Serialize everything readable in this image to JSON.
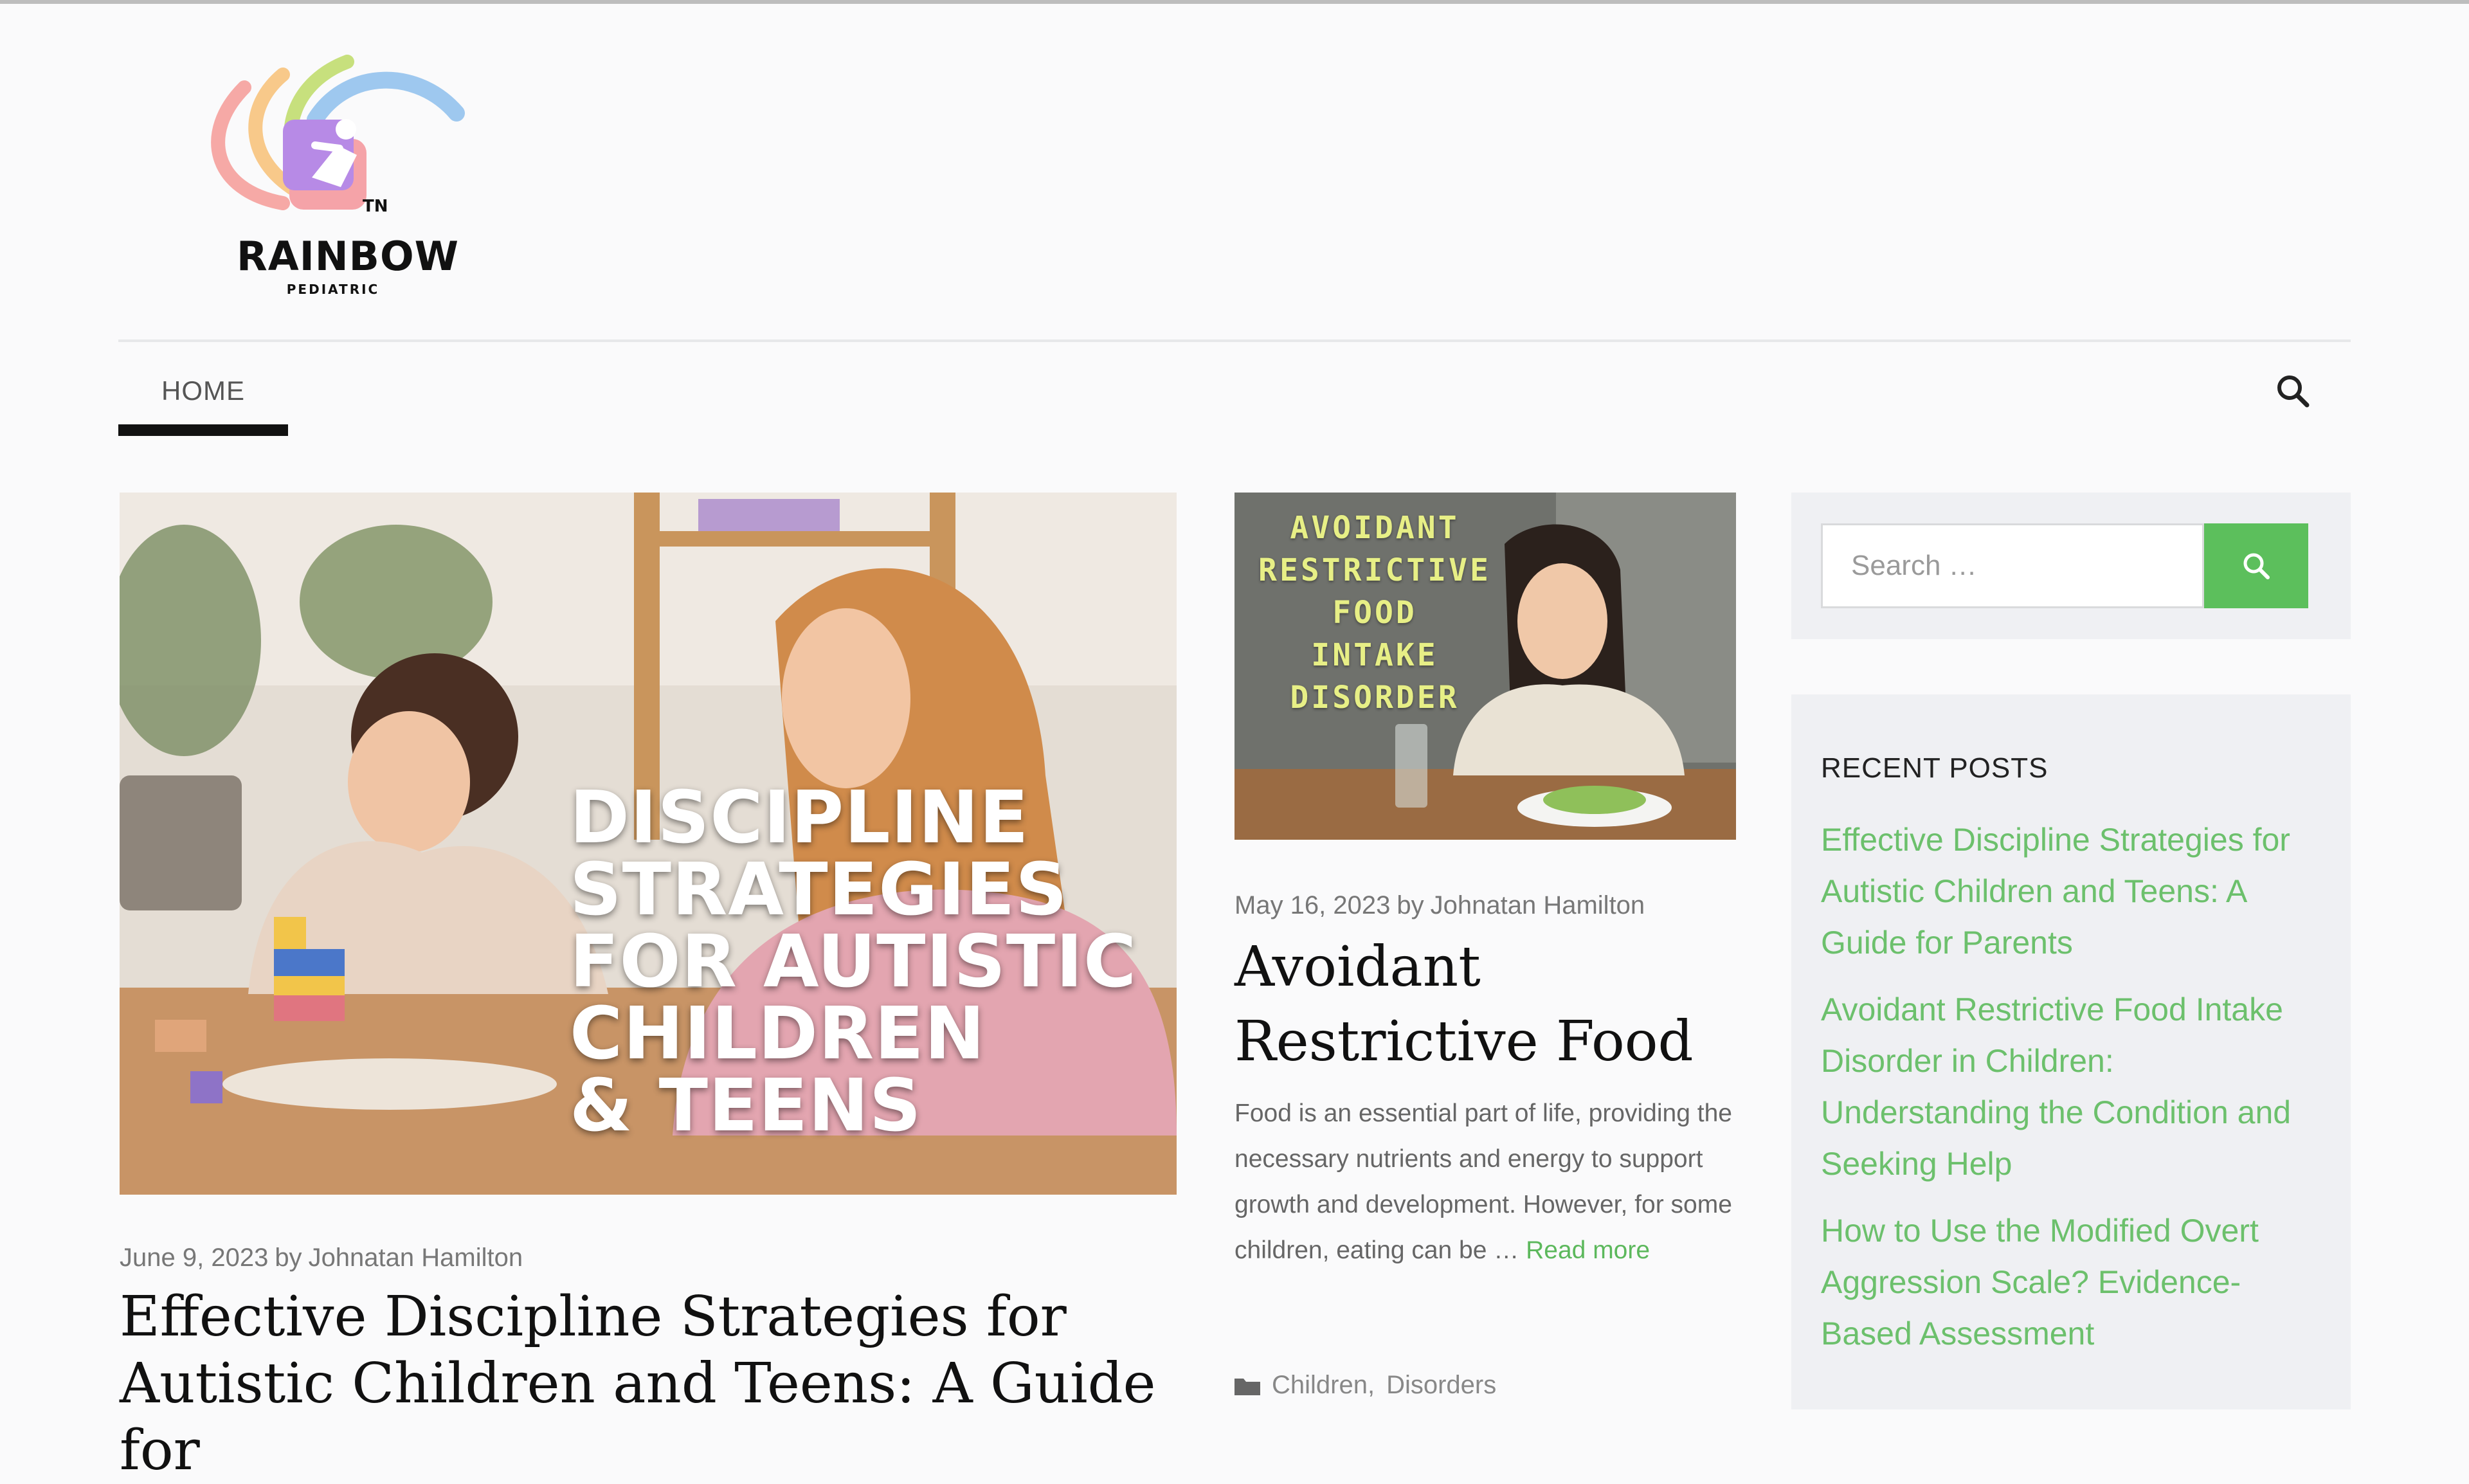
{
  "header": {
    "logo_name": "RAINBOW",
    "logo_sub": "PEDIATRIC",
    "logo_tm": "TN"
  },
  "nav": {
    "items": [
      {
        "label": "HOME",
        "active": true
      }
    ]
  },
  "featured_post": {
    "image_overlay_lines": [
      "DISCIPLINE",
      "STRATEGIES",
      "FOR AUTISTIC",
      "CHILDREN",
      "& TEENS"
    ],
    "date": "June 9, 2023",
    "by": "by",
    "author": "Johnatan Hamilton",
    "title": "Effective Discipline Strategies for Autistic Children and Teens: A Guide for"
  },
  "card_post": {
    "image_overlay_lines": [
      "AVOIDANT",
      "RESTRICTIVE",
      "FOOD",
      "INTAKE",
      "DISORDER"
    ],
    "date": "May 16, 2023",
    "by": "by",
    "author": "Johnatan Hamilton",
    "title": "Avoidant Restrictive Food",
    "excerpt": "Food is an essential part of life, providing the necessary nutrients and energy to support growth and development. However, for some children, eating can be …",
    "read_more": "Read more",
    "categories": [
      "Children,",
      "Disorders"
    ]
  },
  "sidebar": {
    "search": {
      "placeholder": "Search …"
    },
    "recent_posts": {
      "heading": "RECENT POSTS",
      "items": [
        "Effective Discipline Strategies for Autistic Children and Teens: A Guide for Parents",
        "Avoidant Restrictive Food Intake Disorder in Children: Understanding the Condition and Seeking Help",
        "How to Use the Modified Overt Aggression Scale? Evidence-Based Assessment"
      ]
    }
  },
  "colors": {
    "accent_green": "#5cbf5c",
    "link_green": "#6cc06c",
    "card_overlay_text": "#e7ef86"
  },
  "icons": [
    "search-icon",
    "folder-icon"
  ]
}
